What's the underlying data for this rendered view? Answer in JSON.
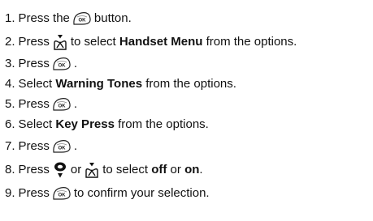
{
  "steps": [
    {
      "num": "1.",
      "parts": [
        {
          "t": "text",
          "v": "Press the"
        },
        {
          "t": "icon",
          "icon": "ok-key-icon"
        },
        {
          "t": "text",
          "v": "button."
        }
      ]
    },
    {
      "num": "2.",
      "parts": [
        {
          "t": "text",
          "v": "Press"
        },
        {
          "t": "icon",
          "icon": "scroll-down-key-icon"
        },
        {
          "t": "text",
          "v": "to select "
        },
        {
          "t": "bold",
          "v": "Handset Menu"
        },
        {
          "t": "text",
          "v": " from the options."
        }
      ]
    },
    {
      "num": "3.",
      "parts": [
        {
          "t": "text",
          "v": "Press"
        },
        {
          "t": "icon",
          "icon": "ok-key-icon"
        },
        {
          "t": "text",
          "v": "."
        }
      ]
    },
    {
      "num": "4.",
      "parts": [
        {
          "t": "text",
          "v": "Select "
        },
        {
          "t": "bold",
          "v": "Warning Tones"
        },
        {
          "t": "text",
          "v": " from the options."
        }
      ]
    },
    {
      "num": "5.",
      "parts": [
        {
          "t": "text",
          "v": "Press"
        },
        {
          "t": "icon",
          "icon": "ok-key-icon"
        },
        {
          "t": "text",
          "v": "."
        }
      ]
    },
    {
      "num": "6.",
      "parts": [
        {
          "t": "text",
          "v": "Select "
        },
        {
          "t": "bold",
          "v": "Key Press"
        },
        {
          "t": "text",
          "v": " from the options."
        }
      ]
    },
    {
      "num": "7.",
      "parts": [
        {
          "t": "text",
          "v": "Press"
        },
        {
          "t": "icon",
          "icon": "ok-key-icon"
        },
        {
          "t": "text",
          "v": "."
        }
      ]
    },
    {
      "num": "8.",
      "parts": [
        {
          "t": "text",
          "v": "Press"
        },
        {
          "t": "icon",
          "icon": "scroll-up-key-icon"
        },
        {
          "t": "text",
          "v": "or"
        },
        {
          "t": "icon",
          "icon": "scroll-down-key-icon"
        },
        {
          "t": "text",
          "v": "to select "
        },
        {
          "t": "bold",
          "v": "off"
        },
        {
          "t": "text",
          "v": " or "
        },
        {
          "t": "bold",
          "v": "on"
        },
        {
          "t": "text",
          "v": "."
        }
      ]
    },
    {
      "num": "9.",
      "parts": [
        {
          "t": "text",
          "v": "Press"
        },
        {
          "t": "icon",
          "icon": "ok-key-icon"
        },
        {
          "t": "text",
          "v": "to confirm your selection."
        }
      ]
    }
  ]
}
